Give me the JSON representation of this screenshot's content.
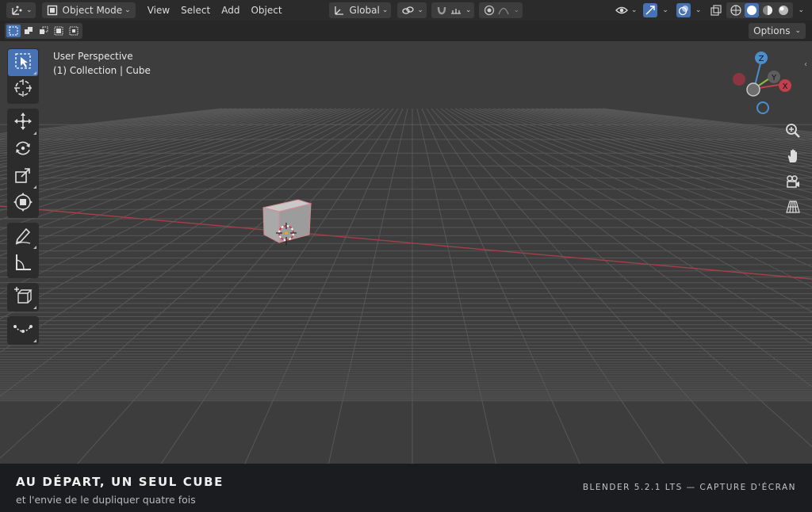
{
  "header": {
    "mode_label": "Object Mode",
    "menus": [
      "View",
      "Select",
      "Add",
      "Object"
    ],
    "orientation_label": "Global"
  },
  "subbar": {
    "options_label": "Options"
  },
  "viewport": {
    "perspective_label": "User Perspective",
    "collection_label": "(1) Collection | Cube",
    "gizmo_axes": {
      "x": "X",
      "y": "Y",
      "z": "Z"
    }
  },
  "toolbar": {
    "tools": [
      "select-box",
      "cursor",
      "move",
      "rotate",
      "scale",
      "transform",
      "annotate",
      "measure",
      "add-cube",
      "extrude"
    ]
  },
  "caption": {
    "title": "AU DÉPART, UN SEUL CUBE",
    "subtitle": "et l'envie de le dupliquer quatre fois",
    "right": "BLENDER 5.2.1 LTS — CAPTURE D'ÉCRAN"
  },
  "colors": {
    "accent": "#4772b3",
    "x_axis": "#c33f4e",
    "y_axis": "#8bbd45",
    "z_axis": "#4a8fcd"
  }
}
